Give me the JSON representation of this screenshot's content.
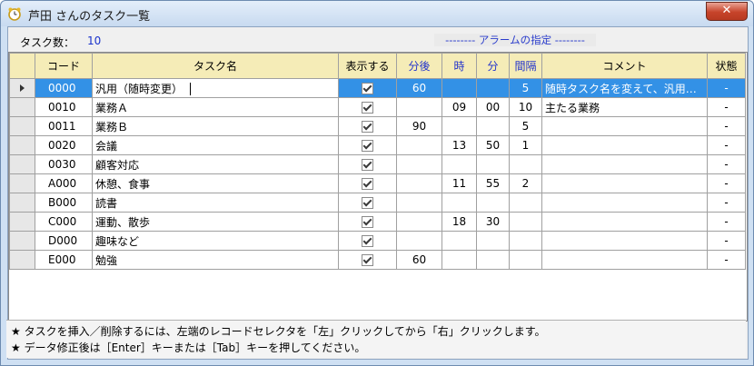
{
  "window": {
    "title": "芦田 さんのタスク一覧",
    "close_label": "✕"
  },
  "summary": {
    "task_count_label": "タスク数：",
    "task_count": "10"
  },
  "alarm_header": "-------- アラームの指定 --------",
  "table": {
    "headers": [
      "",
      "コード",
      "タスク名",
      "表示する",
      "分後",
      "時",
      "分",
      "間隔",
      "コメント",
      "状態"
    ],
    "rows": [
      [
        "0000",
        "汎用（随時変更）",
        true,
        "60",
        "",
        "",
        "5",
        "随時タスク名を変えて、汎用…",
        "-"
      ],
      [
        "0010",
        "業務Ａ",
        true,
        "",
        "09",
        "00",
        "10",
        "主たる業務",
        "-"
      ],
      [
        "0011",
        "業務Ｂ",
        true,
        "90",
        "",
        "",
        "5",
        "",
        "-"
      ],
      [
        "0020",
        "会議",
        true,
        "",
        "13",
        "50",
        "1",
        "",
        "-"
      ],
      [
        "0030",
        "顧客対応",
        true,
        "",
        "",
        "",
        "",
        "",
        "-"
      ],
      [
        "A000",
        "休憩、食事",
        true,
        "",
        "11",
        "55",
        "2",
        "",
        "-"
      ],
      [
        "B000",
        "読書",
        true,
        "",
        "",
        "",
        "",
        "",
        "-"
      ],
      [
        "C000",
        "運動、散歩",
        true,
        "",
        "18",
        "30",
        "",
        "",
        "-"
      ],
      [
        "D000",
        "趣味など",
        true,
        "",
        "",
        "",
        "",
        "",
        "-"
      ],
      [
        "E000",
        "勉強",
        true,
        "60",
        "",
        "",
        "",
        "",
        "-"
      ]
    ]
  },
  "notes": [
    "★ タスクを挿入／削除するには、左端のレコードセレクタを「左」クリックしてから「右」クリックします。",
    "★ データ修正後は［Enter］キーまたは［Tab］キーを押してください。"
  ]
}
